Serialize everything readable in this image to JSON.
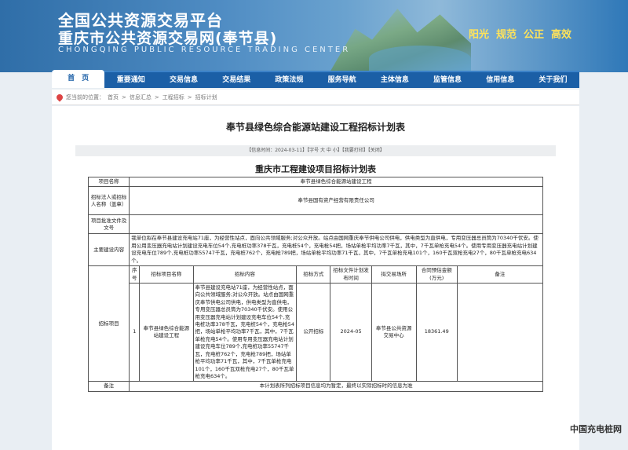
{
  "header": {
    "title_line1": "全国公共资源交易平台",
    "title_line2": "重庆市公共资源交易网(奉节县)",
    "title_en": "CHONGQING PUBLIC RESOURCE TRADING CENTER",
    "slogans": [
      "阳光",
      "规范",
      "公正",
      "高效"
    ]
  },
  "nav": [
    "首　页",
    "重要通知",
    "交易信息",
    "交易结果",
    "政策法规",
    "服务导航",
    "主体信息",
    "监管信息",
    "信用信息",
    "关于我们"
  ],
  "breadcrumb": {
    "prefix": "您当前的位置：",
    "items": [
      "首页",
      "信息汇总",
      "工程招标",
      "招标计划"
    ],
    "sep": ">"
  },
  "article": {
    "title": "奉节县绿色综合能源站建设工程招标计划表",
    "info": "【信息时间：2024-03-11】【字号 大 中 小】【我要打印】【关闭】",
    "table_title": "重庆市工程建设项目招标计划表"
  },
  "table": {
    "project_name_label": "项目名称",
    "project_name": "奉节县绿色综合能源站建设工程",
    "tenderer_label": "招标法人或招标人名称（盖章）",
    "tenderer": "奉节县国有资产经营有限责任公司",
    "approval_label": "项目批准文件及文号",
    "approval": "",
    "content_label": "主要建设内容",
    "content": "我单位拟在奉节县建设充电站71座，为经营性站点，面向公共领域服务;对公众开放。站点由国网重庆奉节供电公司供电，供电类型为直供电，专用变压器总员筒为70340千伏安。使用公用变压器充电站计划建设充电车位54个,充电桩功率378千瓦，充电桩54个，充电枪54把，场站单枪平均功率7千瓦，其中，7千瓦单枪充电54个。使用专用变压器充电站计划建设充电车位789个,充电桩功率55747千瓦，充电桩762个，充电枪789把，场站单枪平均功率71千瓦，其中，7千瓦单枪充电101个，160千瓦双枪充电27个，80千瓦单枪充电634个。",
    "section_label": "招标项目",
    "headers": [
      "序号",
      "招标项目名称",
      "招标内容",
      "招标方式",
      "招标文件计划发布时间",
      "拟交易场所",
      "合同预估金额(万元)",
      "备注"
    ],
    "rows": [
      {
        "no": "1",
        "name": "奉节县绿色综合能源站建设工程",
        "content": "奉节县建设充电站71座，为经营性站点，面向公共领域服务;对公众开放。站点由国网重庆奉节供电公司供电，供电类型为直供电，专用变压器总员筒为70340千伏安。使用公用变压器充电站计划建设充电车位54个,充电桩功率378千瓦，充电桩54个，充电枪54把，场站单枪平均功率7千瓦，其中，7千瓦单枪充电54个。使用专用变压器充电站计划建设充电车位789个,充电桩功率55747千瓦，充电桩762个，充电枪789把，场站单枪平均功率71千瓦，其中，7千瓦单枪充电101个，160千瓦双枪充电27个，80千瓦单枪充电634个。",
        "method": "公开招标",
        "time": "2024-05",
        "place": "奉节县公共资源交易中心",
        "amount": "18361.49",
        "note": ""
      }
    ],
    "remark_label": "备注",
    "remark": "本计划表所列招标项目信息均为暂定，最终以实际招标时的信息为准"
  },
  "watermark": "中国充电桩网"
}
